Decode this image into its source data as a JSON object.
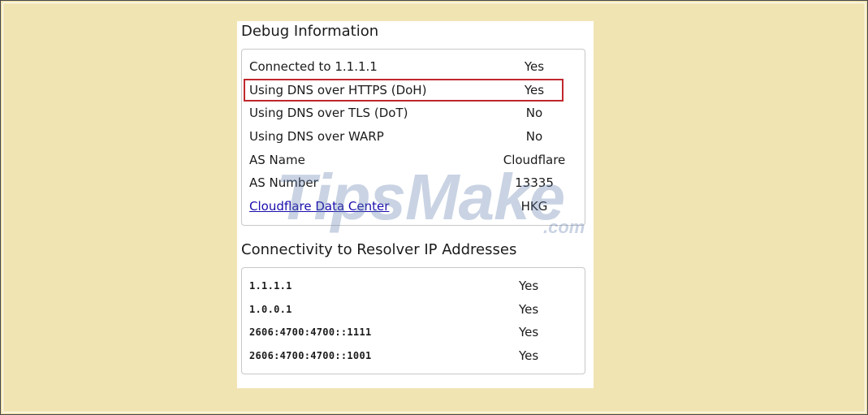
{
  "debug": {
    "title": "Debug Information",
    "rows": [
      {
        "label": "Connected to 1.1.1.1",
        "value": "Yes"
      },
      {
        "label": "Using DNS over HTTPS (DoH)",
        "value": "Yes"
      },
      {
        "label": "Using DNS over TLS (DoT)",
        "value": "No"
      },
      {
        "label": "Using DNS over WARP",
        "value": "No"
      },
      {
        "label": "AS Name",
        "value": "Cloudflare"
      },
      {
        "label": "AS Number",
        "value": "13335"
      },
      {
        "label": "Cloudflare Data Center",
        "value": "HKG"
      }
    ]
  },
  "connectivity": {
    "title": "Connectivity to Resolver IP Addresses",
    "rows": [
      {
        "address": "1.1.1.1",
        "value": "Yes"
      },
      {
        "address": "1.0.0.1",
        "value": "Yes"
      },
      {
        "address": "2606:4700:4700::1111",
        "value": "Yes"
      },
      {
        "address": "2606:4700:4700::1001",
        "value": "Yes"
      }
    ]
  },
  "watermark": {
    "brand": "TipsMake",
    "suffix": ".com"
  },
  "colors": {
    "background": "#f1e4b3",
    "highlight": "#c0282d",
    "link": "#1a0dab"
  }
}
